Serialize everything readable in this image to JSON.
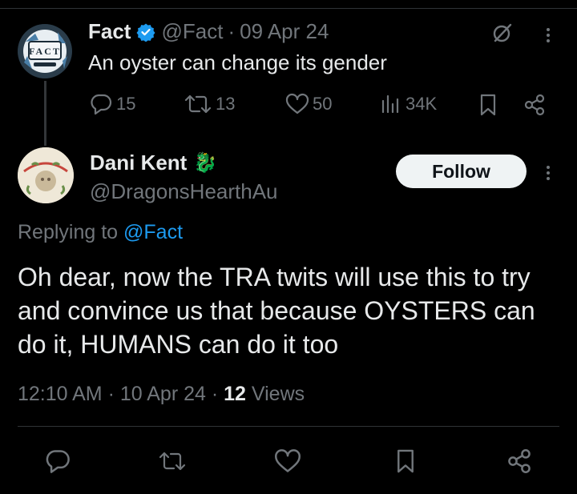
{
  "original_tweet": {
    "author_name": "Fact",
    "handle": "@Fact",
    "separator": "·",
    "date": "09 Apr 24",
    "text": "An oyster can change its gender",
    "avatar_text": "FACT",
    "metrics": {
      "replies": "15",
      "retweets": "13",
      "likes": "50",
      "views": "34K"
    }
  },
  "reply": {
    "author_name": "Dani Kent",
    "author_emoji": "🐉",
    "handle": "@DragonsHearthAu",
    "follow_label": "Follow",
    "replying_prefix": "Replying to",
    "replying_mention": "@Fact",
    "text": "Oh dear, now the TRA twits will use this to try and convince us that because OYSTERS can do it, HUMANS can do it too",
    "time": "12:10 AM",
    "separator": "·",
    "date": "10 Apr 24",
    "views_count": "12",
    "views_label": "Views"
  },
  "colors": {
    "background": "#000000",
    "text_primary": "#e7e9ea",
    "text_muted": "#71767b",
    "accent_blue": "#1d9bf0",
    "follow_bg": "#eff3f4",
    "divider": "#2f3336"
  },
  "icons": {
    "verified": "verified-badge-icon",
    "grok": "grok-icon",
    "more": "more-dots-icon",
    "reply": "reply-bubble-icon",
    "retweet": "retweet-icon",
    "like": "heart-icon",
    "views": "views-bars-icon",
    "bookmark": "bookmark-icon",
    "share": "share-icon"
  }
}
